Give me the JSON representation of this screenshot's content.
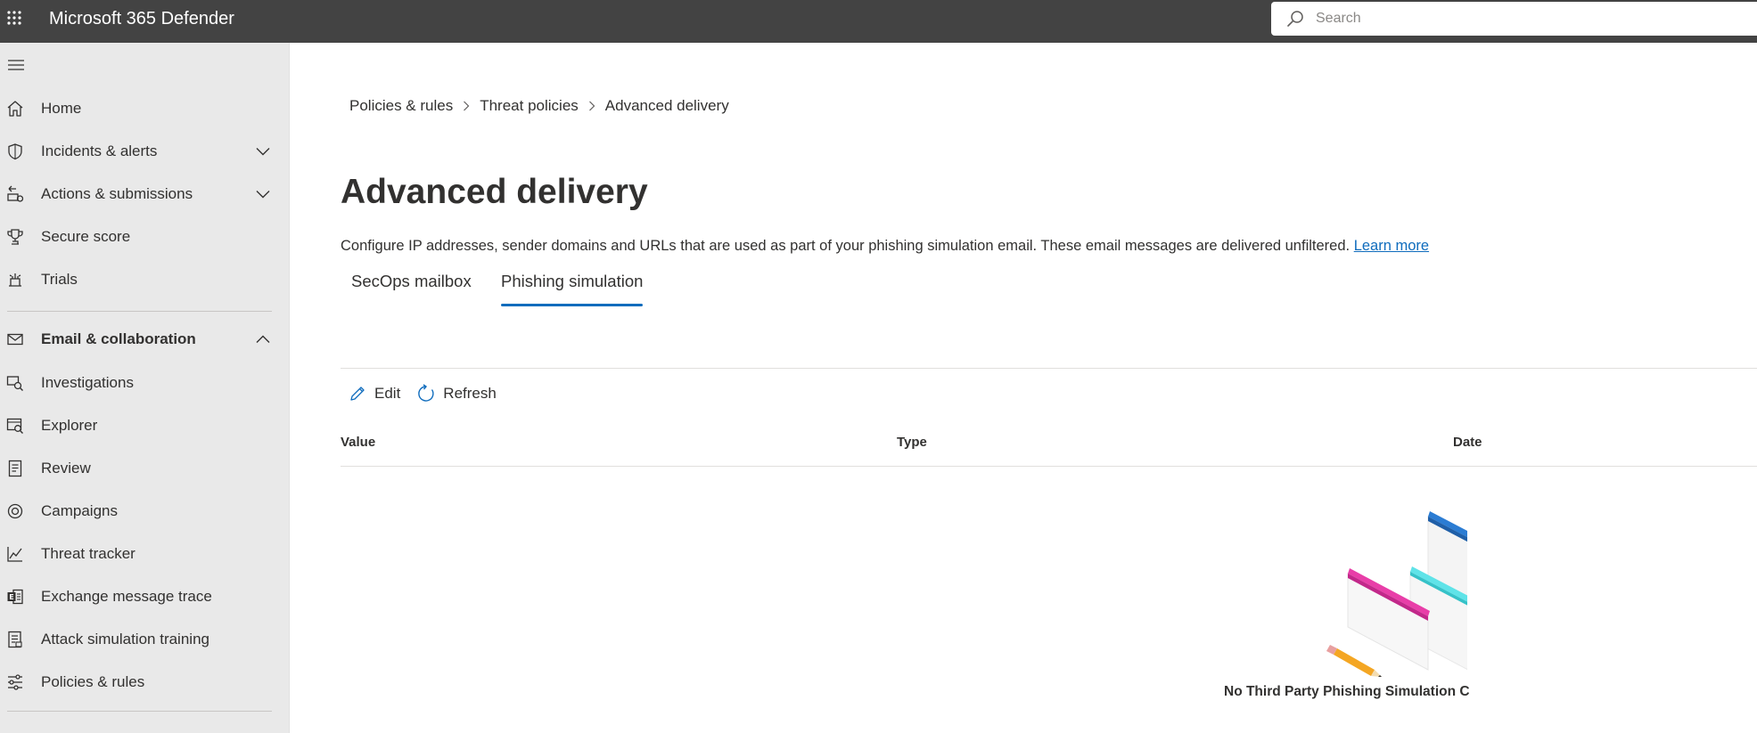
{
  "topbar": {
    "app_title": "Microsoft 365 Defender",
    "search_placeholder": "Search",
    "icons": {
      "waffle": "app-launcher-icon",
      "search": "search-icon"
    },
    "background_color": "#434343"
  },
  "sidebar": {
    "background_color": "#e9e9e9",
    "menu_icon": "hamburger-icon",
    "items": [
      {
        "label": "Home",
        "icon": "home-icon",
        "has_chevron": false
      },
      {
        "label": "Incidents & alerts",
        "icon": "shield-icon",
        "has_chevron": true,
        "chevron": "down"
      },
      {
        "label": "Actions & submissions",
        "icon": "actions-icon",
        "has_chevron": true,
        "chevron": "down"
      },
      {
        "label": "Secure score",
        "icon": "trophy-icon",
        "has_chevron": false
      },
      {
        "label": "Trials",
        "icon": "trials-icon",
        "has_chevron": false
      },
      {
        "label": "Email & collaboration",
        "icon": "mail-icon",
        "has_chevron": true,
        "chevron": "up",
        "section_header": true
      },
      {
        "label": "Investigations",
        "icon": "investigations-icon",
        "has_chevron": false
      },
      {
        "label": "Explorer",
        "icon": "explorer-icon",
        "has_chevron": false
      },
      {
        "label": "Review",
        "icon": "review-icon",
        "has_chevron": false
      },
      {
        "label": "Campaigns",
        "icon": "campaigns-icon",
        "has_chevron": false
      },
      {
        "label": "Threat tracker",
        "icon": "chart-line-icon",
        "has_chevron": false
      },
      {
        "label": "Exchange message trace",
        "icon": "exchange-icon",
        "has_chevron": false
      },
      {
        "label": "Attack simulation training",
        "icon": "simulation-icon",
        "has_chevron": false
      },
      {
        "label": "Policies & rules",
        "icon": "sliders-icon",
        "has_chevron": false
      }
    ]
  },
  "main": {
    "breadcrumb": [
      "Policies & rules",
      "Threat policies",
      "Advanced delivery"
    ],
    "title": "Advanced delivery",
    "description": "Configure IP addresses, sender domains and URLs that are used as part of your phishing simulation email. These email messages are delivered unfiltered.",
    "learn_more": "Learn more",
    "tabs": [
      {
        "label": "SecOps mailbox",
        "active": false
      },
      {
        "label": "Phishing simulation",
        "active": true
      }
    ],
    "accent_color": "#0f6cbd",
    "toolbar": {
      "edit_label": "Edit",
      "refresh_label": "Refresh",
      "icons": {
        "edit": "pencil-icon",
        "refresh": "refresh-icon"
      }
    },
    "table": {
      "columns": [
        "Value",
        "Type",
        "Date"
      ],
      "rows": []
    },
    "empty_state": {
      "illustration": "empty-state-illustration",
      "text": "No Third Party Phishing Simulation C"
    }
  }
}
